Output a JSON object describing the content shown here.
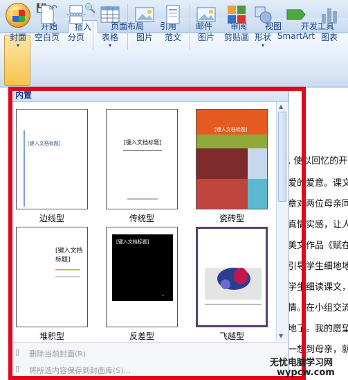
{
  "tabs": [
    "开始",
    "插入",
    "页面布局",
    "引用",
    "邮件",
    "审阅",
    "视图",
    "开发工具"
  ],
  "active_tab": "插入",
  "ribbon": {
    "buttons": [
      "封面",
      "空白页",
      "分页",
      "表格",
      "图片",
      "范文",
      "图片",
      "剪贴画",
      "形状",
      "SmartArt",
      "图表"
    ]
  },
  "gallery": {
    "header": "内置",
    "items": [
      {
        "label": "边线型",
        "title": "[键入文档标题]"
      },
      {
        "label": "传统型",
        "title": "[键入文档标题]"
      },
      {
        "label": "瓷砖型",
        "title": "[键入文档标题]"
      },
      {
        "label": "堆积型",
        "title": "[键入文档标题]"
      },
      {
        "label": "反差型",
        "title": "[键入文档标题]"
      },
      {
        "label": "飞越型",
        "title": ""
      }
    ],
    "footer": [
      "删除当前封面(R)",
      "将所选内容保存到封面库(S)..."
    ]
  },
  "document_lines": [
    ", 使以回忆的开",
    "爱的爱意。课文",
    "章对两位母亲同",
    "真情实感，让人",
    "美文作品《赋在",
    "引导学生细地地",
    "学生细读课文，",
    "情。在小组交流",
    "地了。我的愿望",
    "一想到母亲，就"
  ],
  "watermark": {
    "line1": "无忧电脑学习网",
    "line2": "wypcw.com"
  }
}
